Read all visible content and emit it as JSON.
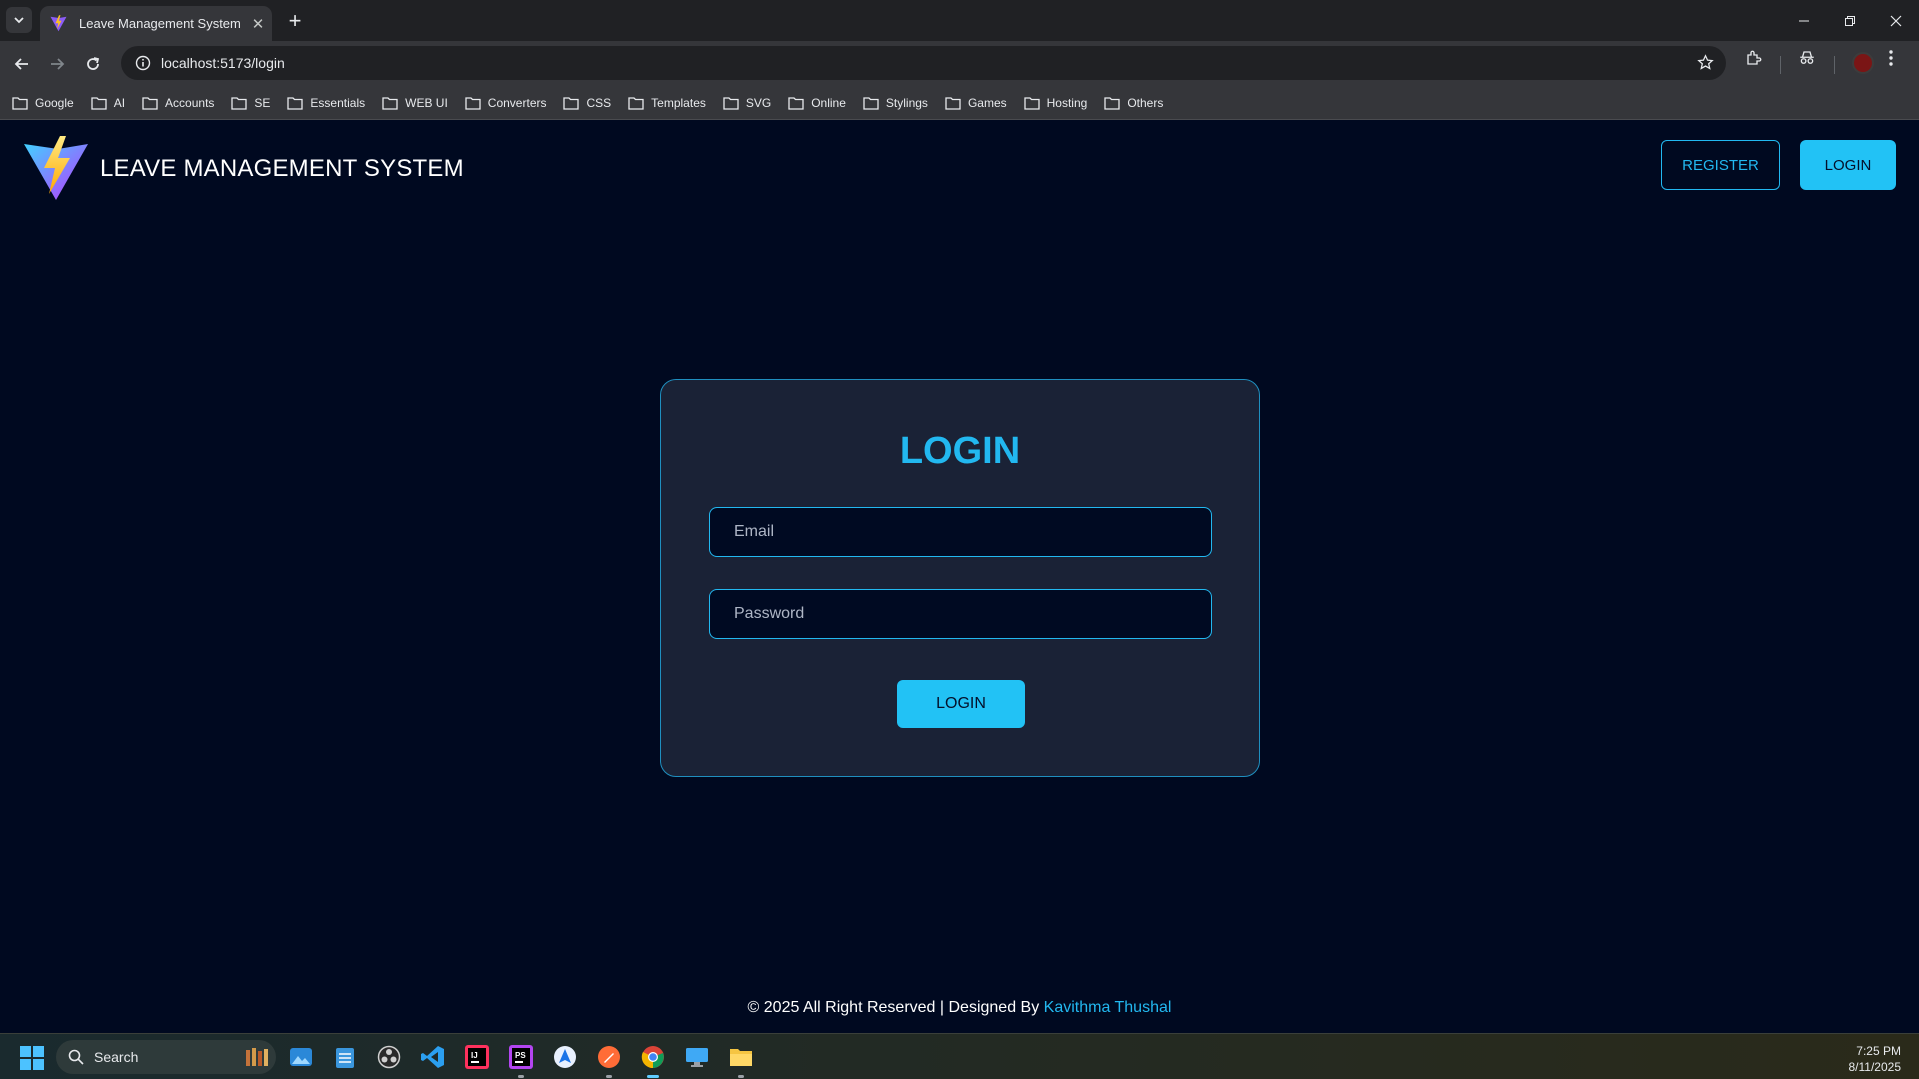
{
  "browser": {
    "tab_title": "Leave Management System",
    "new_tab": "+",
    "url": "localhost:5173/login",
    "bookmarks": [
      "Google",
      "AI",
      "Accounts",
      "SE",
      "Essentials",
      "WEB UI",
      "Converters",
      "CSS",
      "Templates",
      "SVG",
      "Online",
      "Stylings",
      "Games",
      "Hosting",
      "Others"
    ]
  },
  "header": {
    "title": "LEAVE MANAGEMENT SYSTEM",
    "register_label": "REGISTER",
    "login_label": "LOGIN"
  },
  "login_form": {
    "title": "LOGIN",
    "email_placeholder": "Email",
    "password_placeholder": "Password",
    "submit_label": "LOGIN"
  },
  "footer": {
    "text": "© 2025 All Right Reserved | Designed By ",
    "author": "Kavithma Thushal"
  },
  "taskbar": {
    "search_label": "Search",
    "time": "7:25 PM",
    "date": "8/11/2025"
  },
  "colors": {
    "page_bg": "#000920",
    "accent": "#22c2f5",
    "card_bg": "#1a2236"
  }
}
